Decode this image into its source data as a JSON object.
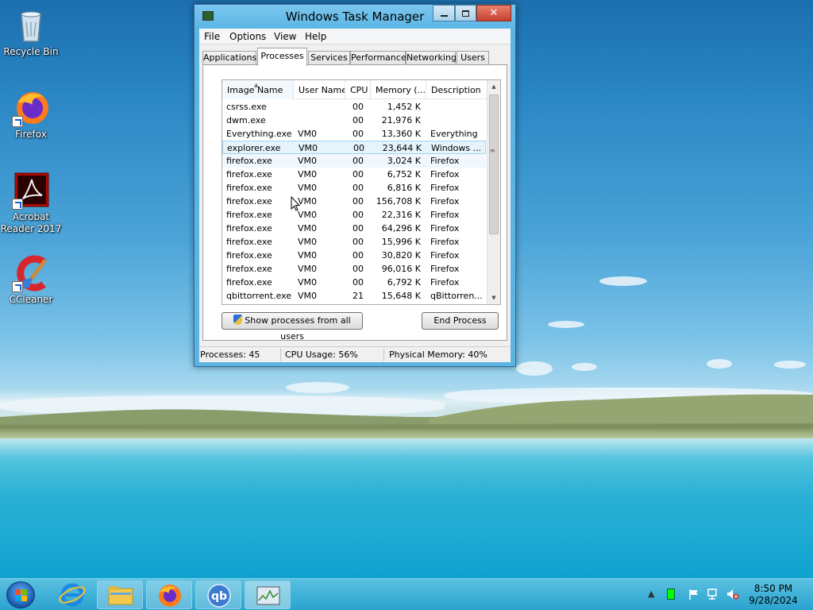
{
  "desktop": {
    "icons": [
      {
        "label": "Recycle Bin",
        "icon": "recycle-bin-icon"
      },
      {
        "label": "Firefox",
        "icon": "firefox-icon"
      },
      {
        "label": "Acrobat Reader 2017",
        "line1": "Acrobat",
        "line2": "Reader 2017",
        "icon": "acrobat-reader-icon"
      },
      {
        "label": "CCleaner",
        "icon": "ccleaner-icon"
      }
    ]
  },
  "window": {
    "title": "Windows Task Manager",
    "menu": [
      "File",
      "Options",
      "View",
      "Help"
    ],
    "tabs": [
      "Applications",
      "Processes",
      "Services",
      "Performance",
      "Networking",
      "Users"
    ],
    "active_tab": "Processes",
    "columns": [
      "Image Name",
      "User Name",
      "CPU",
      "Memory (...",
      "Description"
    ],
    "rows": [
      {
        "name": "csrss.exe",
        "user": "",
        "cpu": "00",
        "mem": "1,452 K",
        "desc": ""
      },
      {
        "name": "dwm.exe",
        "user": "",
        "cpu": "00",
        "mem": "21,976 K",
        "desc": ""
      },
      {
        "name": "Everything.exe",
        "user": "VM0",
        "cpu": "00",
        "mem": "13,360 K",
        "desc": "Everything"
      },
      {
        "name": "explorer.exe",
        "user": "VM0",
        "cpu": "00",
        "mem": "23,644 K",
        "desc": "Windows ..."
      },
      {
        "name": "firefox.exe",
        "user": "VM0",
        "cpu": "00",
        "mem": "3,024 K",
        "desc": "Firefox"
      },
      {
        "name": "firefox.exe",
        "user": "VM0",
        "cpu": "00",
        "mem": "6,752 K",
        "desc": "Firefox"
      },
      {
        "name": "firefox.exe",
        "user": "VM0",
        "cpu": "00",
        "mem": "6,816 K",
        "desc": "Firefox"
      },
      {
        "name": "firefox.exe",
        "user": "VM0",
        "cpu": "00",
        "mem": "156,708 K",
        "desc": "Firefox"
      },
      {
        "name": "firefox.exe",
        "user": "VM0",
        "cpu": "00",
        "mem": "22,316 K",
        "desc": "Firefox"
      },
      {
        "name": "firefox.exe",
        "user": "VM0",
        "cpu": "00",
        "mem": "64,296 K",
        "desc": "Firefox"
      },
      {
        "name": "firefox.exe",
        "user": "VM0",
        "cpu": "00",
        "mem": "15,996 K",
        "desc": "Firefox"
      },
      {
        "name": "firefox.exe",
        "user": "VM0",
        "cpu": "00",
        "mem": "30,820 K",
        "desc": "Firefox"
      },
      {
        "name": "firefox.exe",
        "user": "VM0",
        "cpu": "00",
        "mem": "96,016 K",
        "desc": "Firefox"
      },
      {
        "name": "firefox.exe",
        "user": "VM0",
        "cpu": "00",
        "mem": "6,792 K",
        "desc": "Firefox"
      },
      {
        "name": "qbittorrent.exe",
        "user": "VM0",
        "cpu": "21",
        "mem": "15,648 K",
        "desc": "qBittorren..."
      }
    ],
    "selected_row": 3,
    "show_all_label": "Show processes from all users",
    "end_process_label": "End Process",
    "status": {
      "processes": "Processes: 45",
      "cpu": "CPU Usage: 56%",
      "memory": "Physical Memory: 40%"
    }
  },
  "taskbar": {
    "pinned": [
      "internet-explorer-icon",
      "file-explorer-icon",
      "firefox-icon",
      "qbittorrent-icon",
      "task-manager-icon"
    ],
    "time": "8:50 PM",
    "date": "9/28/2024"
  }
}
